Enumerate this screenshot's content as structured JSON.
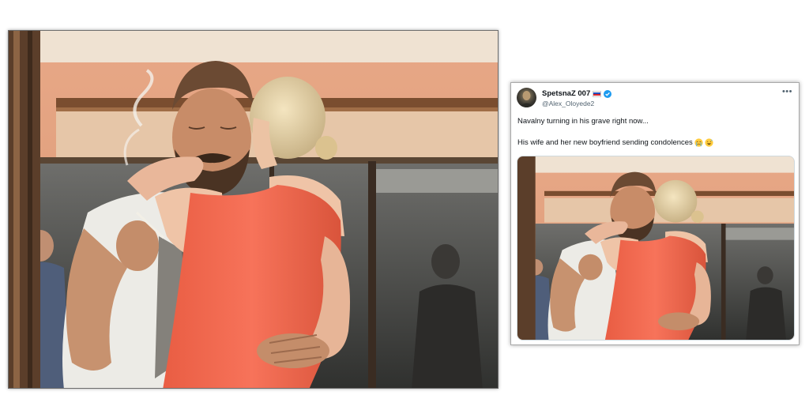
{
  "images": {
    "main_photo_alt": "",
    "tweet_photo_alt": ""
  },
  "tweet": {
    "display_name": "SpetsnaZ 007",
    "handle": "@Alex_Oloyede2",
    "more_label": "•••",
    "line1": "Navalny turning in his grave right now...",
    "line2": "His wife and her new boyfriend sending condolences",
    "emoji_1": "crying-face",
    "emoji_2": "grinning-sweat-face"
  },
  "colors": {
    "verified_blue": "#1d9bf0",
    "text": "#0f1419",
    "muted": "#536471",
    "dress": "#f26a4f",
    "wall": "#e3a27f"
  }
}
